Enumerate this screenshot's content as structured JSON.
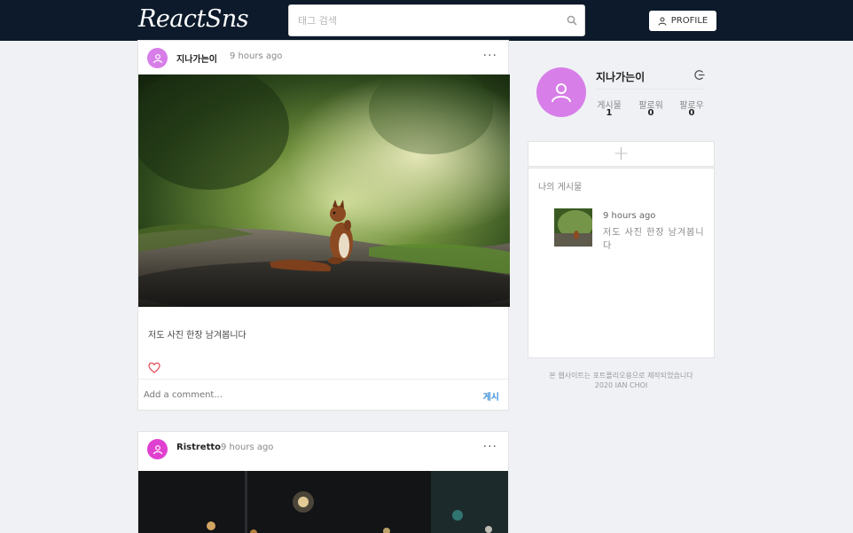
{
  "header": {
    "logo": "ReactSns",
    "search_placeholder": "태그 검색",
    "profile_label": "PROFILE"
  },
  "posts": [
    {
      "author": "지나가는이",
      "time": "9 hours ago",
      "caption": "저도 사진 한장 남겨봅니다",
      "comment_placeholder": "Add a comment...",
      "submit_label": "게시",
      "avatar_color": "#d77ee8"
    },
    {
      "author": "Ristretto",
      "time": "9 hours ago",
      "avatar_color": "#e040d0"
    }
  ],
  "sidebar": {
    "username": "지나가는이",
    "stats": [
      {
        "label": "게시물",
        "value": "1"
      },
      {
        "label": "팔로워",
        "value": "0"
      },
      {
        "label": "팔로우",
        "value": "0"
      }
    ],
    "add_symbol": "+",
    "my_posts_title": "나의 게시물",
    "my_post": {
      "time": "9 hours ago",
      "caption": "저도 사진 한장 남겨봅니다"
    },
    "footer_line1": "본 웹사이트는 포트폴리오용으로 제작되었습니다",
    "footer_line2": "2020 IAN CHOI"
  },
  "colors": {
    "header_bg": "#0c1a2b",
    "accent_blue": "#3d8fd9",
    "like_red": "#e8505b",
    "avatar_purple": "#d77ee8"
  }
}
